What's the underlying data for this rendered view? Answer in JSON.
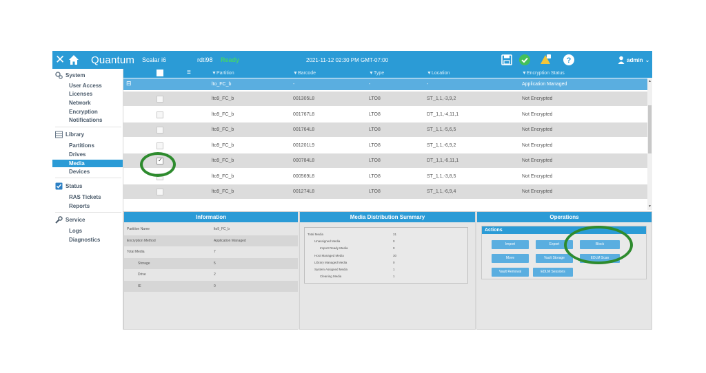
{
  "topbar": {
    "close_glyph": "✕",
    "home_icon": "home-icon",
    "brand": "Quantum",
    "product": "Scalar i6",
    "host": "rdti98",
    "state": "Ready",
    "datetime": "2021-11-12 02:30 PM GMT-07:00",
    "icons": [
      "save-icon",
      "check-icon",
      "notification-icon",
      "help-icon"
    ],
    "user": "admin"
  },
  "sidebar": {
    "system": {
      "title": "System",
      "items": [
        "User Access",
        "Licenses",
        "Network",
        "Encryption",
        "Notifications"
      ]
    },
    "library": {
      "title": "Library",
      "items": [
        "Partitions",
        "Drives",
        "Media",
        "Devices"
      ],
      "active": "Media"
    },
    "status": {
      "title": "Status",
      "items": [
        "RAS Tickets",
        "Reports"
      ]
    },
    "service": {
      "title": "Service",
      "items": [
        "Logs",
        "Diagnostics"
      ]
    }
  },
  "grid": {
    "columns": [
      "Partition",
      "Barcode",
      "Type",
      "Location",
      "Encryption Status"
    ],
    "group": {
      "toggle": "⊟",
      "partition": "lto_FC_b",
      "barcode": "-",
      "type": "-",
      "location": "-",
      "encryption": "Application Managed"
    },
    "rows": [
      {
        "partition": "lto9_FC_b",
        "barcode": "001305L8",
        "type": "LTO8",
        "location": "ST_1,1,-3,9,2",
        "encryption": "Not Encrypted",
        "checked": false
      },
      {
        "partition": "lto9_FC_b",
        "barcode": "001767L8",
        "type": "LTO8",
        "location": "DT_1,1,-4,11,1",
        "encryption": "Not Encrypted",
        "checked": false
      },
      {
        "partition": "lto9_FC_b",
        "barcode": "001764L8",
        "type": "LTO8",
        "location": "ST_1,1,-5,6,5",
        "encryption": "Not Encrypted",
        "checked": false
      },
      {
        "partition": "lto9_FC_b",
        "barcode": "001201L9",
        "type": "LTO8",
        "location": "ST_1,1,-6,9,2",
        "encryption": "Not Encrypted",
        "checked": false
      },
      {
        "partition": "lto9_FC_b",
        "barcode": "000784L8",
        "type": "LTO8",
        "location": "DT_1,1,-6,11,1",
        "encryption": "Not Encrypted",
        "checked": true
      },
      {
        "partition": "lto9_FC_b",
        "barcode": "000569L8",
        "type": "LTO8",
        "location": "ST_1,1,-3,8,5",
        "encryption": "Not Encrypted",
        "checked": false
      },
      {
        "partition": "lto9_FC_b",
        "barcode": "001274L8",
        "type": "LTO8",
        "location": "ST_1,1,-6,9,4",
        "encryption": "Not Encrypted",
        "checked": false
      }
    ]
  },
  "information": {
    "title": "Information",
    "rows": [
      {
        "label": "Partition Name",
        "value": "lto9_FC_b"
      },
      {
        "label": "Encryption Method",
        "value": "Application Managed"
      },
      {
        "label": "Total Media",
        "value": "7"
      },
      {
        "label": "Storage",
        "value": "5"
      },
      {
        "label": "Drive",
        "value": "2"
      },
      {
        "label": "IE",
        "value": "0"
      }
    ]
  },
  "mds": {
    "title": "Media Distribution Summary",
    "rows": [
      {
        "label": "Total Media",
        "value": "31"
      },
      {
        "label": "Unassigned Media",
        "value": "0"
      },
      {
        "label": "Import Ready Media",
        "value": "0"
      },
      {
        "label": "Host Managed Media",
        "value": "30"
      },
      {
        "label": "Library Managed Media",
        "value": "0"
      },
      {
        "label": "System Assigned Media",
        "value": "1"
      },
      {
        "label": "Cleaning Media",
        "value": "1"
      }
    ]
  },
  "operations": {
    "title": "Operations",
    "actions_title": "Actions",
    "buttons": [
      "Import",
      "Export",
      "Block",
      "Move",
      "Vault Storage",
      "EDLM Scan",
      "Vault Removal",
      "EDLM Sessions"
    ]
  },
  "colors": {
    "accent": "#2b9bd6",
    "row_alt": "#dcdcdc",
    "ready": "#43d56b",
    "highlight_ring": "#2e8b2e"
  }
}
